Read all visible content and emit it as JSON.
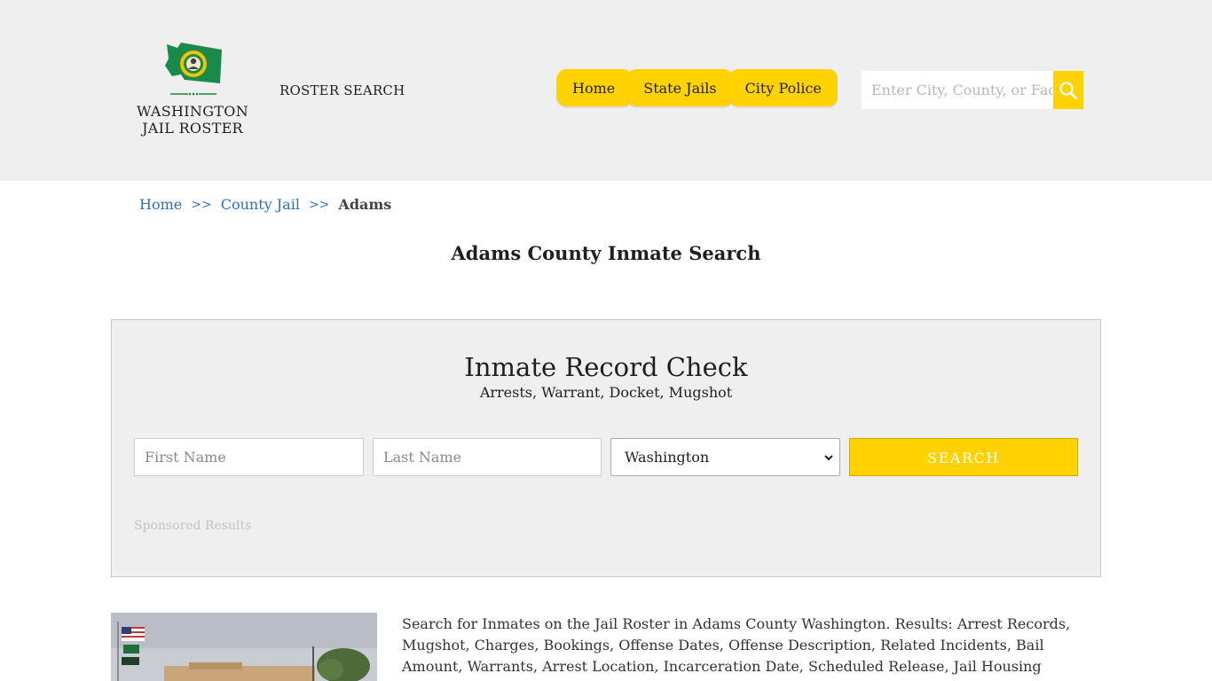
{
  "header": {
    "logo_lines": [
      "WASHINGTON",
      "JAIL ROSTER"
    ],
    "roster_search_label": "ROSTER SEARCH",
    "nav": [
      {
        "label": "Home"
      },
      {
        "label": "State Jails"
      },
      {
        "label": "City Police"
      }
    ],
    "search_placeholder": "Enter City, County, or Facility"
  },
  "breadcrumb": {
    "items": [
      "Home",
      "County Jail"
    ],
    "separator": ">>",
    "current": "Adams"
  },
  "page_title": "Adams County Inmate Search",
  "record_check": {
    "title": "Inmate Record Check",
    "subtitle": "Arrests, Warrant, Docket, Mugshot",
    "first_name_placeholder": "First Name",
    "last_name_placeholder": "Last Name",
    "state_selected": "Washington",
    "search_button": "SEARCH",
    "sponsored_label": "Sponsored Results"
  },
  "description": "Search for Inmates on the Jail Roster in Adams County Washington. Results: Arrest Records, Mugshot, Charges, Bookings, Offense Dates, Offense Description, Related Incidents, Bail Amount, Warrants, Arrest Location, Incarceration Date, Scheduled Release, Jail Housing Location, Court.",
  "colors": {
    "accent": "#ffd200",
    "header_bg": "#efefef",
    "link": "#2f6fbf"
  }
}
